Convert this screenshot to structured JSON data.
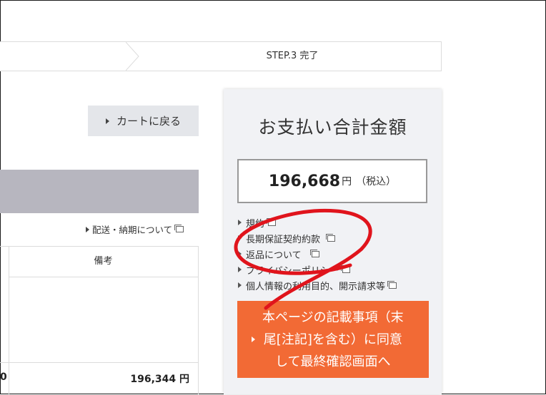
{
  "stepbar": {
    "step3_label": "STEP.3 完了"
  },
  "back_button": {
    "label": "カートに戻る"
  },
  "delivery_link": {
    "label": "配送・納期について"
  },
  "table": {
    "header_remarks": "備考",
    "row_price": "196,344 円",
    "clipped_left_text": "0"
  },
  "summary": {
    "title": "お支払い合計金額",
    "total_amount": "196,668",
    "total_yen": "円",
    "total_tax": "（税込）",
    "links": [
      {
        "label": "規約"
      },
      {
        "label": "長期保証契約約款"
      },
      {
        "label": "返品について"
      },
      {
        "label": "プライバシーポリシー"
      },
      {
        "label": "個人情報の利用目的、開示請求等"
      }
    ],
    "confirm_button": {
      "line1": "本ページの記載事項（末",
      "line2": "尾[注記]を含む）に同意",
      "line3": "して最終確認画面へ"
    }
  },
  "colors": {
    "accent_orange": "#f26a35",
    "annotation_red": "#e0141c",
    "header_gray": "#b7b6bf",
    "panel_bg": "#f1f2f5"
  }
}
